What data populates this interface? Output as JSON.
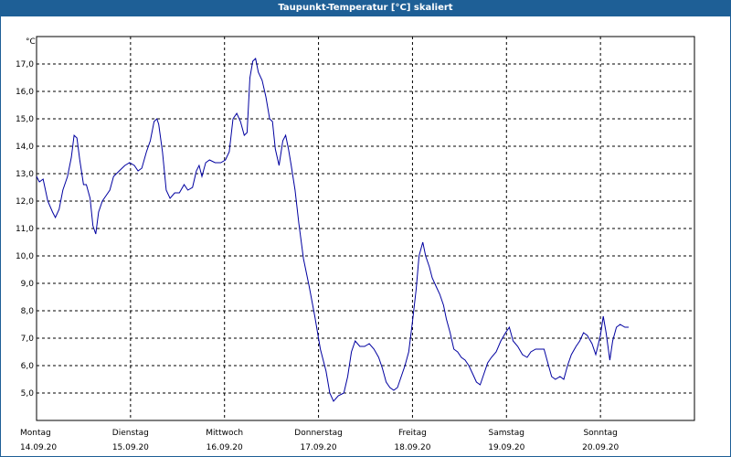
{
  "window": {
    "title": "Taupunkt-Temperatur [°C] skaliert"
  },
  "chart_data": {
    "type": "line",
    "title": "Taupunkt-Temperatur [°C] skaliert",
    "ylabel": "°C",
    "xlabel": "",
    "ylim": [
      4.0,
      18.0
    ],
    "xlim": [
      0,
      7
    ],
    "yticks": [
      "5,0",
      "6,0",
      "7,0",
      "8,0",
      "9,0",
      "10,0",
      "11,0",
      "12,0",
      "13,0",
      "14,0",
      "15,0",
      "16,0",
      "17,0"
    ],
    "xticks": [
      {
        "day": "Montag",
        "date": "14.09.20"
      },
      {
        "day": "Dienstag",
        "date": "15.09.20"
      },
      {
        "day": "Mittwoch",
        "date": "16.09.20"
      },
      {
        "day": "Donnerstag",
        "date": "17.09.20"
      },
      {
        "day": "Freitag",
        "date": "18.09.20"
      },
      {
        "day": "Samstag",
        "date": "19.09.20"
      },
      {
        "day": "Sonntag",
        "date": "20.09.20"
      }
    ],
    "grid": true,
    "legend": "none",
    "line_color": "#0000a0",
    "series": [
      {
        "values": [
          [
            0.0,
            12.9
          ],
          [
            0.03,
            12.7
          ],
          [
            0.07,
            12.8
          ],
          [
            0.12,
            12.0
          ],
          [
            0.17,
            11.6
          ],
          [
            0.2,
            11.4
          ],
          [
            0.24,
            11.7
          ],
          [
            0.28,
            12.4
          ],
          [
            0.33,
            12.9
          ],
          [
            0.37,
            13.6
          ],
          [
            0.4,
            14.4
          ],
          [
            0.43,
            14.3
          ],
          [
            0.46,
            13.5
          ],
          [
            0.5,
            12.6
          ],
          [
            0.53,
            12.6
          ],
          [
            0.57,
            12.1
          ],
          [
            0.6,
            11.1
          ],
          [
            0.63,
            10.8
          ],
          [
            0.66,
            11.6
          ],
          [
            0.7,
            12.0
          ],
          [
            0.74,
            12.2
          ],
          [
            0.78,
            12.4
          ],
          [
            0.82,
            12.9
          ],
          [
            0.88,
            13.1
          ],
          [
            0.94,
            13.3
          ],
          [
            0.99,
            13.4
          ],
          [
            1.04,
            13.3
          ],
          [
            1.08,
            13.1
          ],
          [
            1.12,
            13.2
          ],
          [
            1.17,
            13.8
          ],
          [
            1.21,
            14.2
          ],
          [
            1.25,
            14.9
          ],
          [
            1.28,
            15.0
          ],
          [
            1.3,
            14.8
          ],
          [
            1.34,
            13.8
          ],
          [
            1.38,
            12.4
          ],
          [
            1.42,
            12.1
          ],
          [
            1.47,
            12.3
          ],
          [
            1.52,
            12.3
          ],
          [
            1.57,
            12.6
          ],
          [
            1.61,
            12.4
          ],
          [
            1.66,
            12.5
          ],
          [
            1.7,
            13.1
          ],
          [
            1.73,
            13.3
          ],
          [
            1.76,
            12.9
          ],
          [
            1.8,
            13.4
          ],
          [
            1.84,
            13.5
          ],
          [
            1.9,
            13.4
          ],
          [
            1.96,
            13.4
          ],
          [
            2.01,
            13.5
          ],
          [
            2.05,
            13.8
          ],
          [
            2.09,
            15.0
          ],
          [
            2.13,
            15.2
          ],
          [
            2.17,
            14.9
          ],
          [
            2.21,
            14.4
          ],
          [
            2.24,
            14.5
          ],
          [
            2.27,
            16.5
          ],
          [
            2.3,
            17.1
          ],
          [
            2.33,
            17.2
          ],
          [
            2.36,
            16.7
          ],
          [
            2.4,
            16.4
          ],
          [
            2.44,
            15.8
          ],
          [
            2.48,
            15.0
          ],
          [
            2.51,
            14.9
          ],
          [
            2.54,
            13.9
          ],
          [
            2.58,
            13.3
          ],
          [
            2.62,
            14.2
          ],
          [
            2.65,
            14.4
          ],
          [
            2.68,
            13.9
          ],
          [
            2.71,
            13.3
          ],
          [
            2.75,
            12.4
          ],
          [
            2.79,
            11.2
          ],
          [
            2.84,
            9.9
          ],
          [
            2.9,
            8.9
          ],
          [
            2.96,
            7.8
          ],
          [
            3.02,
            6.6
          ],
          [
            3.08,
            5.8
          ],
          [
            3.12,
            5.0
          ],
          [
            3.16,
            4.7
          ],
          [
            3.21,
            4.9
          ],
          [
            3.27,
            5.0
          ],
          [
            3.31,
            5.6
          ],
          [
            3.35,
            6.5
          ],
          [
            3.39,
            6.9
          ],
          [
            3.44,
            6.7
          ],
          [
            3.49,
            6.7
          ],
          [
            3.54,
            6.8
          ],
          [
            3.59,
            6.6
          ],
          [
            3.64,
            6.3
          ],
          [
            3.68,
            5.9
          ],
          [
            3.72,
            5.4
          ],
          [
            3.76,
            5.2
          ],
          [
            3.8,
            5.1
          ],
          [
            3.84,
            5.2
          ],
          [
            3.88,
            5.6
          ],
          [
            3.92,
            6.0
          ],
          [
            3.96,
            6.5
          ],
          [
            4.0,
            7.6
          ],
          [
            4.04,
            8.8
          ],
          [
            4.07,
            10.0
          ],
          [
            4.11,
            10.5
          ],
          [
            4.14,
            10.0
          ],
          [
            4.18,
            9.6
          ],
          [
            4.21,
            9.2
          ],
          [
            4.25,
            8.9
          ],
          [
            4.29,
            8.6
          ],
          [
            4.33,
            8.2
          ],
          [
            4.36,
            7.7
          ],
          [
            4.4,
            7.2
          ],
          [
            4.44,
            6.6
          ],
          [
            4.48,
            6.5
          ],
          [
            4.52,
            6.3
          ],
          [
            4.56,
            6.2
          ],
          [
            4.6,
            6.0
          ],
          [
            4.64,
            5.7
          ],
          [
            4.68,
            5.4
          ],
          [
            4.72,
            5.3
          ],
          [
            4.76,
            5.7
          ],
          [
            4.8,
            6.1
          ],
          [
            4.84,
            6.3
          ],
          [
            4.89,
            6.5
          ],
          [
            4.94,
            6.9
          ],
          [
            4.99,
            7.2
          ],
          [
            5.03,
            7.4
          ],
          [
            5.07,
            6.9
          ],
          [
            5.12,
            6.7
          ],
          [
            5.17,
            6.4
          ],
          [
            5.22,
            6.3
          ],
          [
            5.26,
            6.5
          ],
          [
            5.31,
            6.6
          ],
          [
            5.36,
            6.6
          ],
          [
            5.4,
            6.6
          ],
          [
            5.44,
            6.1
          ],
          [
            5.48,
            5.6
          ],
          [
            5.52,
            5.5
          ],
          [
            5.57,
            5.6
          ],
          [
            5.61,
            5.5
          ],
          [
            5.65,
            6.0
          ],
          [
            5.69,
            6.4
          ],
          [
            5.74,
            6.7
          ],
          [
            5.78,
            6.9
          ],
          [
            5.82,
            7.2
          ],
          [
            5.86,
            7.1
          ],
          [
            5.91,
            6.8
          ],
          [
            5.95,
            6.4
          ],
          [
            6.0,
            7.1
          ],
          [
            6.03,
            7.8
          ],
          [
            6.06,
            7.2
          ],
          [
            6.1,
            6.2
          ],
          [
            6.13,
            6.9
          ],
          [
            6.17,
            7.4
          ],
          [
            6.21,
            7.5
          ],
          [
            6.26,
            7.4
          ],
          [
            6.3,
            7.4
          ]
        ]
      }
    ]
  }
}
